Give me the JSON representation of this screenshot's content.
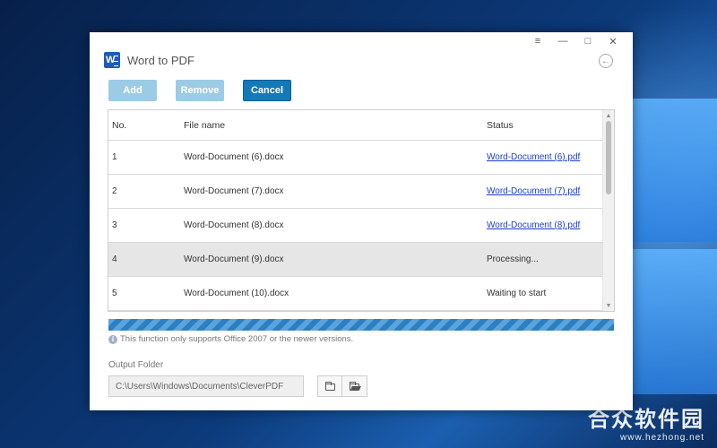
{
  "app": {
    "title": "Word to PDF",
    "icon": "word-icon"
  },
  "window_controls": [
    "≡",
    "—",
    "□",
    "✕"
  ],
  "toolbar": {
    "add_label": "Add",
    "remove_label": "Remove",
    "cancel_label": "Cancel"
  },
  "table": {
    "headers": {
      "no": "No.",
      "file_name": "File name",
      "status": "Status"
    },
    "rows": [
      {
        "no": "1",
        "file_name": "Word-Document (6).docx",
        "status": "Word-Document (6).pdf",
        "status_is_link": true
      },
      {
        "no": "2",
        "file_name": "Word-Document (7).docx",
        "status": "Word-Document (7).pdf",
        "status_is_link": true
      },
      {
        "no": "3",
        "file_name": "Word-Document (8).docx",
        "status": "Word-Document (8).pdf",
        "status_is_link": true
      },
      {
        "no": "4",
        "file_name": "Word-Document (9).docx",
        "status": "Processing...",
        "status_is_link": false
      },
      {
        "no": "5",
        "file_name": "Word-Document (10).docx",
        "status": "Waiting to start",
        "status_is_link": false
      }
    ]
  },
  "progress": {
    "fraction": 1.0
  },
  "info": {
    "text": "This function only supports Office 2007 or the newer versions."
  },
  "output": {
    "label": "Output Folder",
    "path": "C:\\Users\\Windows\\Documents\\CleverPDF"
  },
  "watermark": {
    "main": "合众软件园",
    "sub": "www.hezhong.net"
  },
  "colors": {
    "primary": "#1479b8",
    "disabled": "#9ccbe6",
    "link": "#1a3fd0",
    "selected_row": "#e6e6e6"
  }
}
